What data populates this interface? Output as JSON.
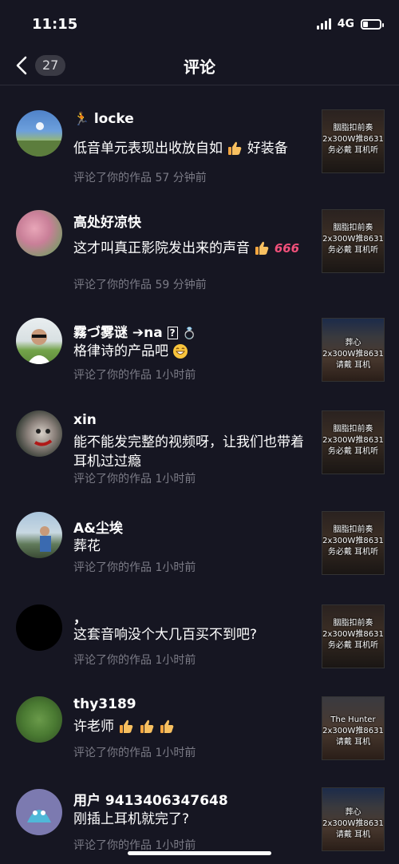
{
  "status": {
    "time": "11:15",
    "network": "4G"
  },
  "nav": {
    "title": "评论",
    "back_count": "27"
  },
  "comments": [
    {
      "name": "locke",
      "text": "低音单元表现出收放自如",
      "text_after": "好装备",
      "meta": "评论了你的作品  57 分钟前",
      "thumb": [
        "胭脂扣前奏",
        "2x300W推8631",
        "务必戴  耳机听"
      ]
    },
    {
      "name": "高处好凉快",
      "text": "这才叫真正影院发出来的声音",
      "text_after": "666",
      "meta": "评论了你的作品  59 分钟前",
      "thumb": [
        "胭脂扣前奏",
        "2x300W推8631",
        "务必戴  耳机听"
      ]
    },
    {
      "name": "霧づ雾谜 ➔na",
      "text": "格律诗的产品吧",
      "meta": "评论了你的作品  1小时前",
      "thumb": [
        "葬心",
        "2x300W推8631",
        "请戴  耳机"
      ]
    },
    {
      "name": "xin",
      "text": "能不能发完整的视频呀，让我们也带着耳机过过瘾",
      "meta": "评论了你的作品  1小时前",
      "thumb": [
        "胭脂扣前奏",
        "2x300W推8631",
        "务必戴  耳机听"
      ]
    },
    {
      "name": "A&尘埃",
      "text": "葬花",
      "meta": "评论了你的作品  1小时前",
      "thumb": [
        "胭脂扣前奏",
        "2x300W推8631",
        "务必戴  耳机听"
      ]
    },
    {
      "name": "，",
      "text": "这套音响没个大几百买不到吧?",
      "meta": "评论了你的作品  1小时前",
      "thumb": [
        "胭脂扣前奏",
        "2x300W推8631",
        "务必戴  耳机听"
      ]
    },
    {
      "name": "thy3189",
      "text": "许老师",
      "meta": "评论了你的作品  1小时前",
      "thumb": [
        "The Hunter",
        "2x300W推8631",
        "请戴  耳机"
      ]
    },
    {
      "name": "用户 9413406347648",
      "text": "刚插上耳机就完了?",
      "meta": "评论了你的作品  1小时前",
      "thumb": [
        "葬心",
        "2x300W推8631",
        "请戴  耳机"
      ]
    }
  ]
}
